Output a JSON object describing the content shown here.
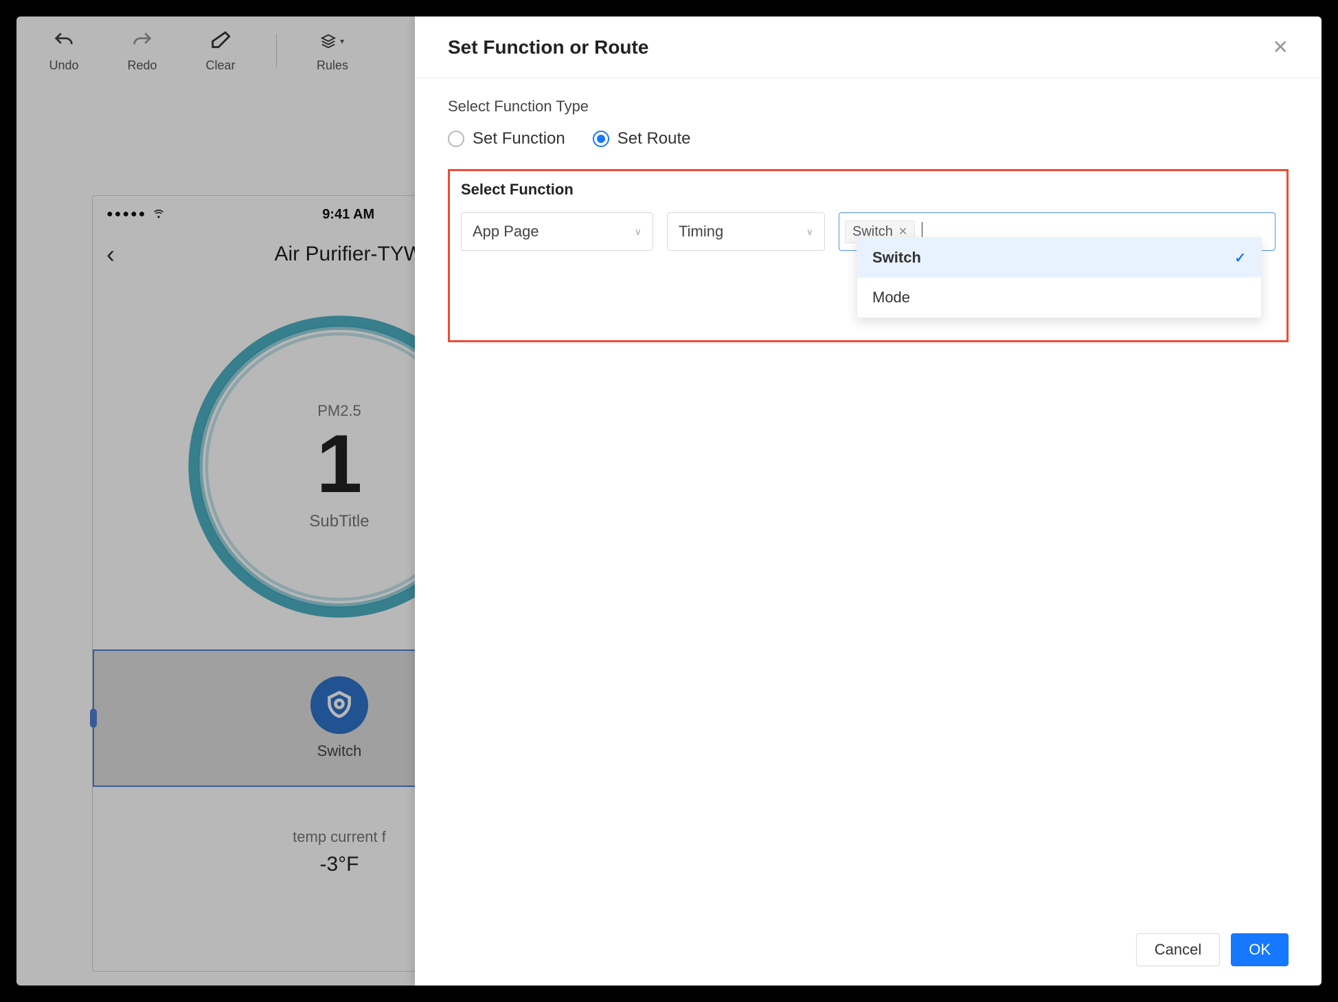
{
  "toolbar": {
    "undo": "Undo",
    "redo": "Redo",
    "clear": "Clear",
    "rules": "Rules"
  },
  "phone": {
    "status_dots": "●●●●●",
    "status_time": "9:41 AM",
    "device_title": "Air Purifier-TYWI",
    "pm25_label": "PM2.5",
    "pm25_value": "1",
    "subtitle": "SubTitle",
    "switch_label": "Switch",
    "temp_label": "temp current f",
    "temp_value": "-3°F"
  },
  "modal": {
    "title": "Set Function or Route",
    "section_type_label": "Select Function Type",
    "radio_set_function": "Set Function",
    "radio_set_route": "Set Route",
    "select_function_label": "Select Function",
    "select1_value": "App Page",
    "select2_value": "Timing",
    "tag_value": "Switch",
    "dropdown_options": [
      {
        "label": "Switch",
        "selected": true
      },
      {
        "label": "Mode",
        "selected": false
      }
    ],
    "cancel_label": "Cancel",
    "ok_label": "OK"
  }
}
